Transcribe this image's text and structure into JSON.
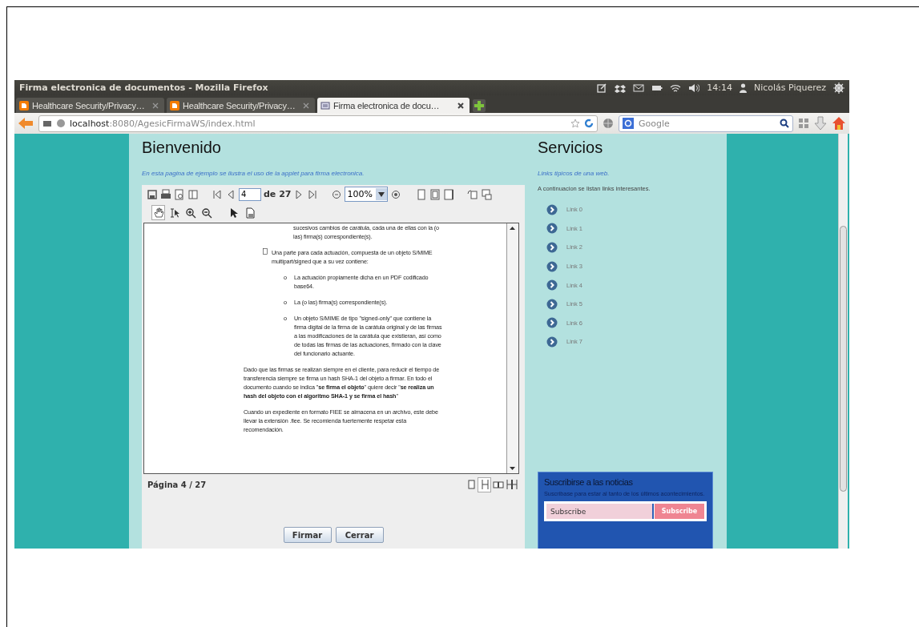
{
  "window": {
    "title": "Firma electronica de documentos - Mozilla Firefox"
  },
  "system_tray": {
    "time": "14:14",
    "user": "Nicolás Piquerez"
  },
  "tabs": [
    {
      "label": "Healthcare Security/Privacy…",
      "selected": false,
      "kind": "blog"
    },
    {
      "label": "Healthcare Security/Privacy…",
      "selected": false,
      "kind": "blog"
    },
    {
      "label": "Firma electronica de docu…",
      "selected": true,
      "kind": "document"
    }
  ],
  "address_bar": {
    "host": "localhost",
    "path": ":8080/AgesicFirmaWS/index.html"
  },
  "search": {
    "placeholder": "Google"
  },
  "main": {
    "heading": "Bienvenido",
    "intro": "En esta pagina de ejemplo se ilustra el uso de la applet para firma electronica."
  },
  "viewer": {
    "page_field": "4",
    "page_total": "de 27",
    "zoom": "100%",
    "tools": [
      {
        "kind": "hand",
        "selected": true
      },
      {
        "kind": "text-select",
        "selected": false
      },
      {
        "kind": "zoom-in",
        "selected": false
      },
      {
        "kind": "zoom-out",
        "selected": false
      },
      {
        "kind": "pointer",
        "selected": false
      },
      {
        "kind": "snapshot",
        "selected": false
      }
    ],
    "document": [
      {
        "kind": "continuation",
        "text": "sucesivos cambios de carátula, cada una de ellas con la (o las) firma(s) correspondiente(s)."
      },
      {
        "kind": "square-bullet",
        "text": "Una parte para cada actuación, compuesta de un objeto S/MIME multipart/signed que a su vez contiene:"
      },
      {
        "kind": "sub-bullet",
        "marker": "o",
        "text": "La actuación propiamente dicha en un PDF codificado base64."
      },
      {
        "kind": "sub-bullet",
        "marker": "o",
        "text": "La (o las) firma(s) correspondiente(s)."
      },
      {
        "kind": "sub-bullet",
        "marker": "o",
        "text": "Un objeto S/MIME de tipo \"signed-only\" que contiene la firma digital de la firma de la carátula original y de las firmas a las modificaciones de la carátula que existieran, así como de todas las firmas de las actuaciones, firmado con la clave del funcionario actuante."
      },
      {
        "kind": "paragraph",
        "text": "Dado que las firmas se realizan siempre en el cliente, para reducir el tiempo de transferencia siempre se firma un hash SHA-1 del objeto a firmar. En todo el documento cuando se indica \"**se firma el objeto**\" quiere decir \"**se realiza un hash del objeto con el algoritmo SHA-1 y se firma el hash**\""
      },
      {
        "kind": "paragraph",
        "text": "Cuando un expediente en formato FIEE se almacena en un archivo, este debe llevar la extensión .fiee. Se recomienda fuertemente respetar esta recomendación."
      }
    ],
    "status": "Página 4 / 27",
    "layouts": [
      {
        "kind": "single",
        "selected": false
      },
      {
        "kind": "continuous",
        "selected": true
      },
      {
        "kind": "facing",
        "selected": false
      },
      {
        "kind": "continuous-facing",
        "selected": false
      }
    ]
  },
  "buttons": [
    {
      "label": "Firmar"
    },
    {
      "label": "Cerrar"
    }
  ],
  "sidebar": {
    "heading": "Servicios",
    "intro": "Links tipicos de una web.",
    "lead": "A continuacion se listan links interesantes.",
    "links": [
      "Link 0",
      "Link 1",
      "Link 2",
      "Link 3",
      "Link 4",
      "Link 5",
      "Link 6",
      "Link 7"
    ]
  },
  "newsletter": {
    "heading": "Suscribirse a las noticias",
    "text": "Suscribase para estar al tanto de los últimos acontecimientos.",
    "placeholder": "Subscribe",
    "button": "Subscribe"
  }
}
